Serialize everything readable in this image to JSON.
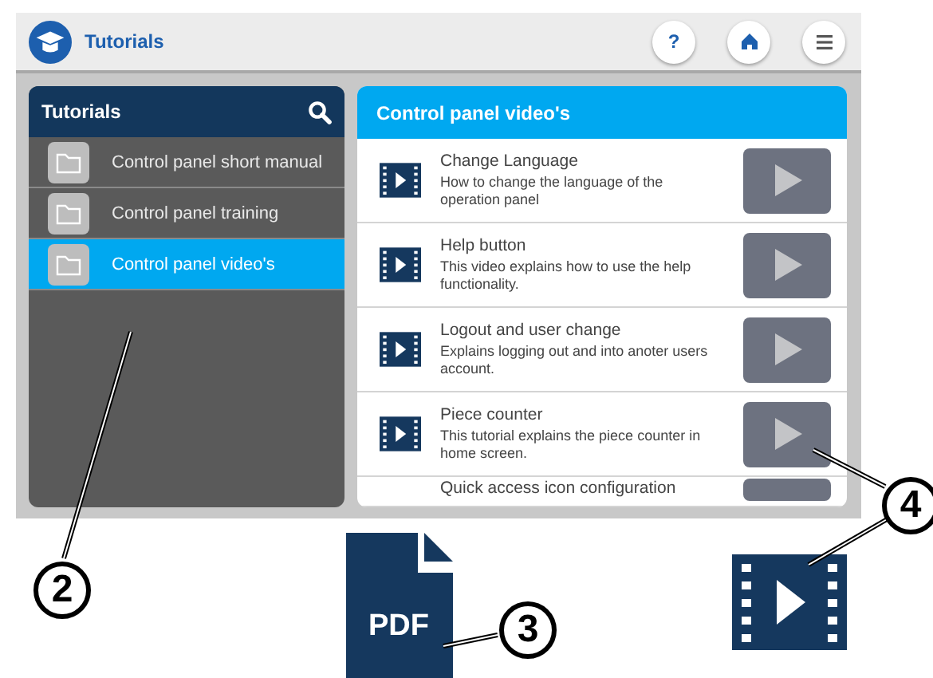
{
  "app_bar": {
    "title": "Tutorials",
    "help_button": "?"
  },
  "sidebar": {
    "title": "Tutorials",
    "items": [
      {
        "label": "Control panel short manual",
        "selected": false
      },
      {
        "label": "Control panel training",
        "selected": false
      },
      {
        "label": "Control panel video's",
        "selected": true
      }
    ]
  },
  "content": {
    "title": "Control panel video's",
    "videos": [
      {
        "title": "Change Language",
        "description": "How to change the language of the operation panel"
      },
      {
        "title": "Help button",
        "description": "This video explains how to use the help functionality."
      },
      {
        "title": "Logout and user change",
        "description": "Explains logging out and into anoter users account."
      },
      {
        "title": "Piece counter",
        "description": "This tutorial explains the piece counter in home screen."
      },
      {
        "title": "Quick access icon configuration"
      }
    ]
  },
  "legend": {
    "pdf_label": "PDF"
  },
  "callouts": [
    {
      "label": "2"
    },
    {
      "label": "3"
    },
    {
      "label": "4"
    }
  ]
}
